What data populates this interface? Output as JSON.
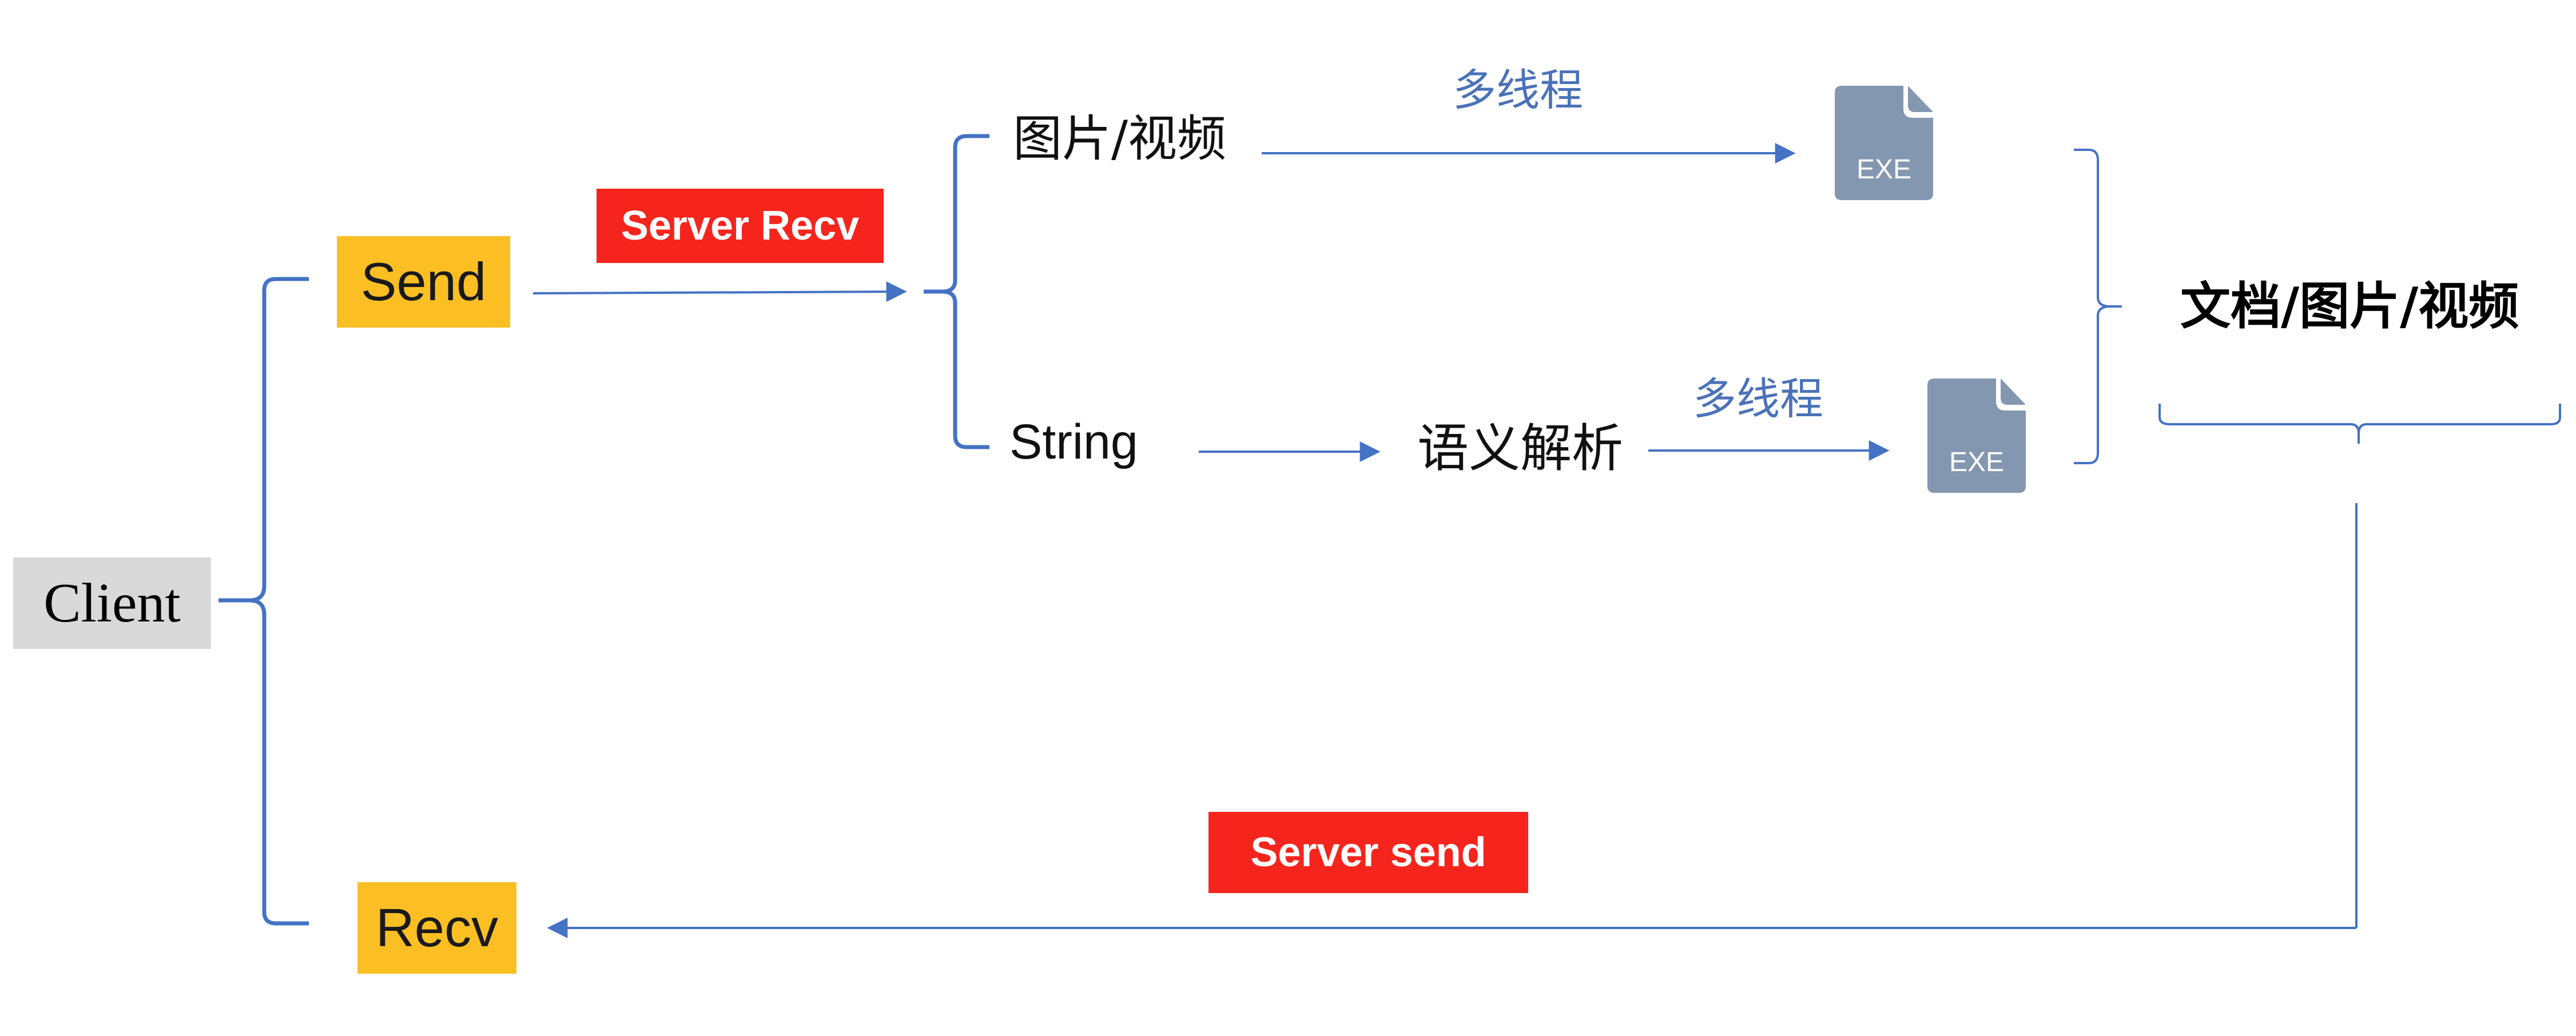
{
  "nodes": {
    "client": "Client",
    "send": "Send",
    "recv": "Recv",
    "server_recv": "Server Recv",
    "server_send": "Server send",
    "image_video": "图片/视频",
    "string": "String",
    "semantic_parsing": "语义解析",
    "output": "文档/图片/视频"
  },
  "edge_labels": {
    "multithread_top": "多线程",
    "multithread_bottom": "多线程"
  },
  "files": [
    {
      "label": "EXE",
      "icon": "exe-file-icon"
    },
    {
      "label": "EXE",
      "icon": "exe-file-icon"
    }
  ],
  "colors": {
    "connector": "#4472c4",
    "red_tag": "#f5251d",
    "yellow_box": "#fbbf24",
    "client_box": "#d9d9d9",
    "file_icon": "#8497b0"
  }
}
